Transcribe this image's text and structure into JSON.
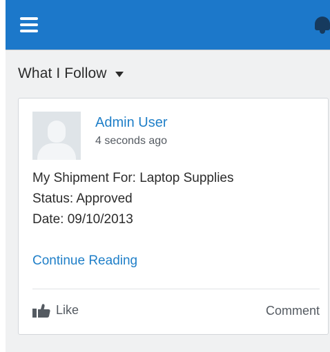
{
  "colors": {
    "header_bg": "#1c78ca",
    "page_bg": "#f0f1f2",
    "link": "#1f7fc8",
    "text": "#2b2b2b",
    "muted": "#545a61"
  },
  "header": {
    "menu_icon": "hamburger-menu-icon",
    "notification_icon": "bell-icon"
  },
  "feed": {
    "filter_label": "What I Follow",
    "filter_icon": "caret-down-icon"
  },
  "post": {
    "author": "Admin User",
    "timestamp": "4 seconds ago",
    "avatar_icon": "default-user-avatar",
    "body": [
      "My Shipment For: Laptop Supplies",
      "Status: Approved",
      "Date: 09/10/2013"
    ],
    "continue_label": "Continue Reading",
    "like_icon": "thumbs-up-icon",
    "like_label": "Like",
    "comment_label": "Comment"
  }
}
